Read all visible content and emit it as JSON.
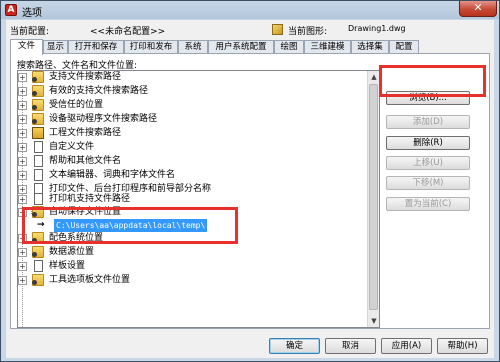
{
  "window": {
    "title": "选项",
    "close_glyph": "✕",
    "app_icon_letter": "A"
  },
  "profile": {
    "current_profile_label": "当前配置:",
    "current_profile_value": "<<未命名配置>>",
    "current_drawing_label": "当前图形:",
    "current_drawing_value": "Drawing1.dwg"
  },
  "tabs": [
    "文件",
    "显示",
    "打开和保存",
    "打印和发布",
    "系统",
    "用户系统配置",
    "绘图",
    "三维建模",
    "选择集",
    "配置"
  ],
  "active_tab": 0,
  "section_label": "搜索路径、文件名和文件位置:",
  "tree": {
    "items": [
      {
        "label": "支持文件搜索路径",
        "icon": "folder-icon",
        "expander": "+"
      },
      {
        "label": "有效的支持文件搜索路径",
        "icon": "folder-icon",
        "expander": "+"
      },
      {
        "label": "受信任的位置",
        "icon": "folder-icon",
        "expander": "+"
      },
      {
        "label": "设备驱动程序文件搜索路径",
        "icon": "folder-icon",
        "expander": "+"
      },
      {
        "label": "工程文件搜索路径",
        "icon": "book-icon",
        "expander": "+"
      },
      {
        "label": "自定义文件",
        "icon": "page-icon",
        "expander": "+"
      },
      {
        "label": "帮助和其他文件名",
        "icon": "page-icon",
        "expander": "+"
      },
      {
        "label": "文本编辑器、词典和字体文件名",
        "icon": "page-icon",
        "expander": "+"
      },
      {
        "label": "打印文件、后台打印程序和前导部分名称",
        "icon": "page-icon",
        "expander": "+"
      },
      {
        "label": "打印机支持文件路径",
        "icon": "page-icon",
        "expander": "+"
      },
      {
        "label": "自动保存文件位置",
        "icon": "folder-icon",
        "expander": "−"
      },
      {
        "label": "配色系统位置",
        "icon": "folder-icon",
        "expander": "+"
      },
      {
        "label": "数据源位置",
        "icon": "folder-icon",
        "expander": "+"
      },
      {
        "label": "样板设置",
        "icon": "page-icon",
        "expander": "+"
      },
      {
        "label": "工具选项板文件位置",
        "icon": "folder-icon",
        "expander": "+"
      }
    ],
    "autosave_path": "C:\\Users\\aa\\appdata\\local\\temp\\",
    "path_arrow": "→"
  },
  "buttons": {
    "browse": "浏览(B)...",
    "add": "添加(D)",
    "remove": "删除(R)",
    "move_up": "上移(U)",
    "move_down": "下移(M)",
    "set_current": "置为当前(C)",
    "ok": "确定",
    "cancel": "取消",
    "apply": "应用(A)",
    "help": "帮助(H)"
  },
  "colors": {
    "highlight": "#e8312c",
    "selection": "#3399ff"
  }
}
